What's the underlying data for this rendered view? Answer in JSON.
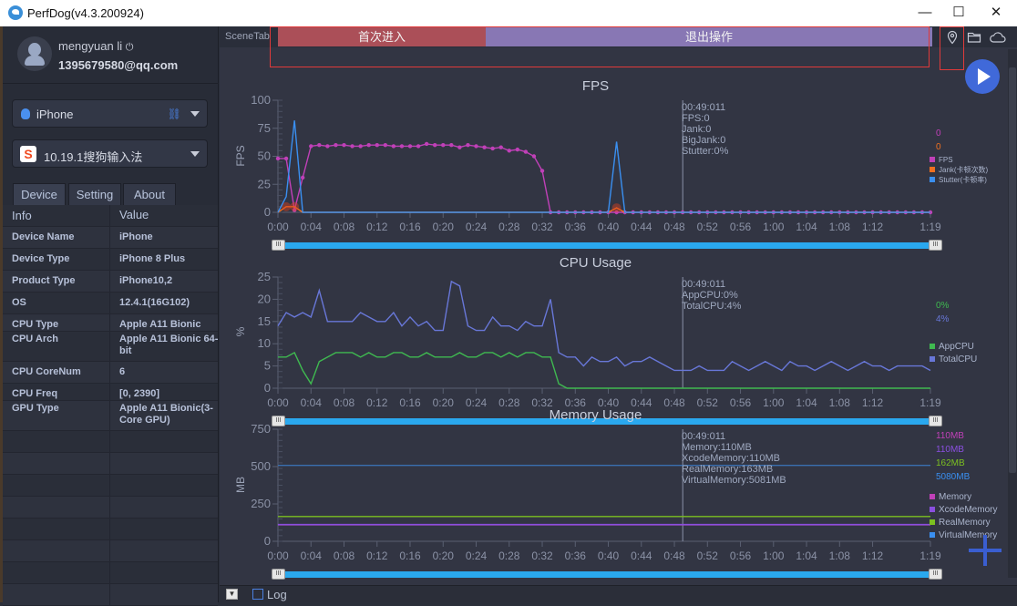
{
  "window": {
    "title": "PerfDog(v4.3.200924)",
    "minimize": "—",
    "maximize": "☐",
    "close": "✕"
  },
  "user": {
    "name": "mengyuan li",
    "power_icon": "⏻",
    "email": "1395679580@qq.com"
  },
  "device_select": {
    "value": "iPhone",
    "icon": "apple-icon"
  },
  "app_select": {
    "value": "10.19.1搜狗输入法",
    "icon": "sogou-app-icon"
  },
  "tabs": [
    {
      "label": "Device"
    },
    {
      "label": "Setting"
    },
    {
      "label": "About"
    }
  ],
  "info_table": {
    "headers": [
      "Info",
      "Value"
    ],
    "rows": [
      {
        "k": "Device Name",
        "v": "iPhone"
      },
      {
        "k": "Device Type",
        "v": "iPhone 8 Plus"
      },
      {
        "k": "Product Type",
        "v": "iPhone10,2"
      },
      {
        "k": "OS",
        "v": "12.4.1(16G102)"
      },
      {
        "k": "CPU Type",
        "v": "Apple A11 Bionic"
      },
      {
        "k": "CPU Arch",
        "v": "Apple A11 Bionic 64-bit"
      },
      {
        "k": "CPU CoreNum",
        "v": "6"
      },
      {
        "k": "CPU Freq",
        "v": "[0, 2390]"
      },
      {
        "k": "GPU Type",
        "v": "Apple A11 Bionic(3-Core GPU)"
      }
    ]
  },
  "scene": {
    "label": "SceneTab",
    "segments": [
      {
        "label": "首次进入",
        "color": "#ab4f58"
      },
      {
        "label": "退出操作",
        "color": "#8877b4"
      }
    ]
  },
  "bottom": {
    "log_label": "Log"
  },
  "cursor_time": "00:49:011",
  "chart_data": [
    {
      "type": "line",
      "title": "FPS",
      "ylabel": "FPS",
      "ylim": [
        0,
        100
      ],
      "yticks": [
        "0",
        "25",
        "50",
        "75",
        "100"
      ],
      "xticks": [
        "0:00",
        "0:04",
        "0:08",
        "0:12",
        "0:16",
        "0:20",
        "0:24",
        "0:28",
        "0:32",
        "0:36",
        "0:40",
        "0:44",
        "0:48",
        "0:52",
        "0:56",
        "1:00",
        "1:04",
        "1:08",
        "1:12",
        "1:19"
      ],
      "xmax_seconds": 79,
      "info": [
        "00:49:011",
        "FPS:0",
        "Jank:0",
        "BigJank:0",
        "Stutter:0%"
      ],
      "latest_values": [
        {
          "text": "0",
          "color": "#c040b8"
        },
        {
          "text": "0",
          "color": "#f07020"
        }
      ],
      "legend": [
        {
          "name": "FPS",
          "color": "#c040b8"
        },
        {
          "name": "Jank(卡顿次数)",
          "color": "#f07020"
        },
        {
          "name": "Stutter(卡顿率)",
          "color": "#3a8ff0"
        }
      ],
      "series": [
        {
          "name": "FPS",
          "color": "#c040b8",
          "markers": true,
          "values": [
            48,
            48,
            2,
            31,
            59,
            60,
            59,
            60,
            60,
            59,
            59,
            60,
            60,
            60,
            59,
            59,
            59,
            59,
            61,
            60,
            60,
            60,
            58,
            60,
            59,
            58,
            57,
            58,
            55,
            56,
            54,
            50,
            37,
            0,
            0,
            0,
            0,
            0,
            0,
            0,
            0,
            0,
            0,
            0,
            0,
            0,
            0,
            0,
            0,
            0,
            0,
            0,
            0,
            0,
            0,
            0,
            0,
            0,
            0,
            0,
            0,
            0,
            0,
            0,
            0,
            0,
            0,
            0,
            0,
            0,
            0,
            0,
            0,
            0,
            0,
            0,
            0,
            0,
            0,
            0
          ]
        },
        {
          "name": "Jank",
          "color": "#f07020",
          "values": [
            0,
            5,
            5,
            0,
            0,
            0,
            0,
            0,
            0,
            0,
            0,
            0,
            0,
            0,
            0,
            0,
            0,
            0,
            0,
            0,
            0,
            0,
            0,
            0,
            0,
            0,
            0,
            0,
            0,
            0,
            0,
            0,
            0,
            0,
            0,
            0,
            0,
            0,
            0,
            0,
            0,
            4,
            0,
            0,
            0,
            0,
            0,
            0,
            0,
            0,
            0,
            0,
            0,
            0,
            0,
            0,
            0,
            0,
            0,
            0,
            0,
            0,
            0,
            0,
            0,
            0,
            0,
            0,
            0,
            0,
            0,
            0,
            0,
            0,
            0,
            0,
            0,
            0,
            0,
            0
          ]
        },
        {
          "name": "Stutter",
          "color": "#3a8ff0",
          "values": [
            0,
            14,
            82,
            0,
            0,
            0,
            0,
            0,
            0,
            0,
            0,
            0,
            0,
            0,
            0,
            0,
            0,
            0,
            0,
            0,
            0,
            0,
            0,
            0,
            0,
            0,
            0,
            0,
            0,
            0,
            0,
            0,
            0,
            0,
            0,
            0,
            0,
            0,
            0,
            0,
            0,
            63,
            0,
            0,
            0,
            0,
            0,
            0,
            0,
            0,
            0,
            0,
            0,
            0,
            0,
            0,
            0,
            0,
            0,
            0,
            0,
            0,
            0,
            0,
            0,
            0,
            0,
            0,
            0,
            0,
            0,
            0,
            0,
            0,
            0,
            0,
            0,
            0,
            0,
            0
          ]
        }
      ]
    },
    {
      "type": "line",
      "title": "CPU Usage",
      "ylabel": "%",
      "ylim": [
        0,
        25
      ],
      "yticks": [
        "0",
        "5",
        "10",
        "15",
        "20",
        "25"
      ],
      "xticks": [
        "0:00",
        "0:04",
        "0:08",
        "0:12",
        "0:16",
        "0:20",
        "0:24",
        "0:28",
        "0:32",
        "0:36",
        "0:40",
        "0:44",
        "0:48",
        "0:52",
        "0:56",
        "1:00",
        "1:04",
        "1:08",
        "1:12",
        "1:19"
      ],
      "xmax_seconds": 79,
      "info": [
        "00:49:011",
        "AppCPU:0%",
        "TotalCPU:4%"
      ],
      "latest_values": [
        {
          "text": "0%",
          "color": "#3fb950"
        },
        {
          "text": "4%",
          "color": "#6877d8"
        }
      ],
      "legend": [
        {
          "name": "AppCPU",
          "color": "#3fb950"
        },
        {
          "name": "TotalCPU",
          "color": "#6877d8"
        }
      ],
      "series": [
        {
          "name": "AppCPU",
          "color": "#3fb950",
          "values": [
            7,
            7,
            8,
            4,
            1,
            6,
            7,
            8,
            8,
            8,
            7,
            8,
            7,
            7,
            8,
            8,
            7,
            7,
            8,
            7,
            7,
            7,
            8,
            7,
            7,
            8,
            8,
            7,
            8,
            7,
            8,
            8,
            7,
            7,
            1,
            0,
            0,
            0,
            0,
            0,
            0,
            0,
            0,
            0,
            0,
            0,
            0,
            0,
            0,
            0,
            0,
            0,
            0,
            0,
            0,
            0,
            0,
            0,
            0,
            0,
            0,
            0,
            0,
            0,
            0,
            0,
            0,
            0,
            0,
            0,
            0,
            0,
            0,
            0,
            0,
            0,
            0,
            0,
            0,
            0
          ]
        },
        {
          "name": "TotalCPU",
          "color": "#6877d8",
          "values": [
            14,
            17,
            16,
            17,
            16,
            22,
            15,
            15,
            15,
            15,
            17,
            16,
            15,
            15,
            17,
            14,
            16,
            14,
            15,
            13,
            13,
            24,
            23,
            14,
            13,
            13,
            16,
            14,
            14,
            13,
            15,
            14,
            14,
            20,
            8,
            7,
            7,
            5,
            7,
            6,
            6,
            7,
            5,
            6,
            6,
            7,
            6,
            5,
            4,
            4,
            4,
            5,
            4,
            4,
            4,
            6,
            5,
            4,
            5,
            6,
            5,
            4,
            6,
            5,
            5,
            4,
            5,
            6,
            5,
            4,
            5,
            6,
            5,
            5,
            4,
            5,
            5,
            5,
            5,
            4
          ]
        }
      ]
    },
    {
      "type": "line",
      "title": "Memory Usage",
      "ylabel": "MB",
      "ylim": [
        0,
        750
      ],
      "yticks": [
        "0",
        "250",
        "500",
        "750"
      ],
      "xticks": [
        "0:00",
        "0:04",
        "0:08",
        "0:12",
        "0:16",
        "0:20",
        "0:24",
        "0:28",
        "0:32",
        "0:36",
        "0:40",
        "0:44",
        "0:48",
        "0:52",
        "0:56",
        "1:00",
        "1:04",
        "1:08",
        "1:12",
        "1:19"
      ],
      "xmax_seconds": 79,
      "info": [
        "00:49:011",
        "Memory:110MB",
        "XcodeMemory:110MB",
        "RealMemory:163MB",
        "VirtualMemory:5081MB"
      ],
      "latest_values": [
        {
          "text": "110MB",
          "color": "#c040b8"
        },
        {
          "text": "110MB",
          "color": "#8a4fe0"
        },
        {
          "text": "162MB",
          "color": "#7cc020"
        },
        {
          "text": "5080MB",
          "color": "#3a8ff0"
        }
      ],
      "legend": [
        {
          "name": "Memory",
          "color": "#c040b8"
        },
        {
          "name": "XcodeMemory",
          "color": "#8a4fe0"
        },
        {
          "name": "RealMemory",
          "color": "#7cc020"
        },
        {
          "name": "VirtualMemory",
          "color": "#3a8ff0"
        }
      ],
      "series": [
        {
          "name": "Memory",
          "color": "#c040b8",
          "constant": 110
        },
        {
          "name": "XcodeMemory",
          "color": "#8a4fe0",
          "constant": 112
        },
        {
          "name": "RealMemory",
          "color": "#7cc020",
          "constant": 166
        },
        {
          "name": "VirtualMemory",
          "color": "#3a6fb0",
          "constant": 508
        }
      ]
    }
  ]
}
